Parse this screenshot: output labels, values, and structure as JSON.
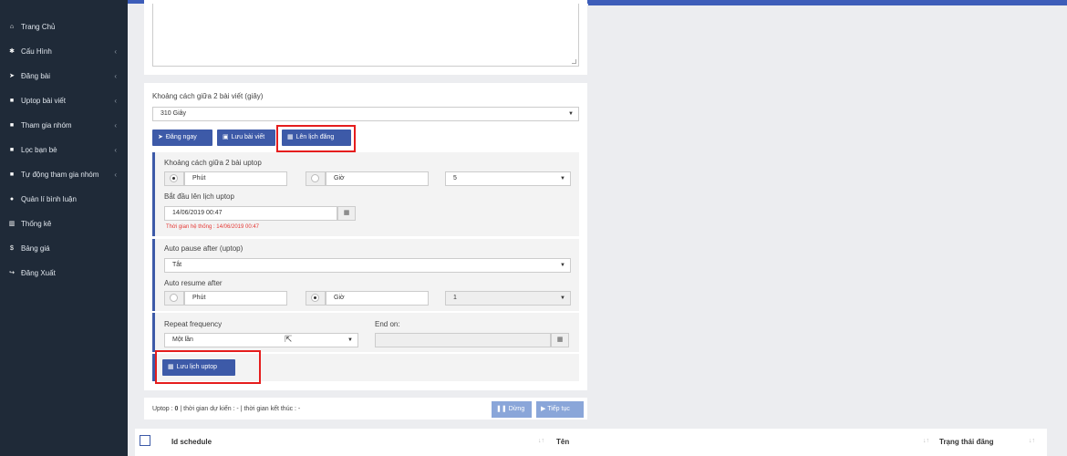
{
  "sidebar": {
    "items": [
      {
        "label": "Trang Chủ",
        "icon": "home-icon",
        "glyph": "⌂",
        "chevron": ""
      },
      {
        "label": "Cấu Hình",
        "icon": "gear-icon",
        "glyph": "✱",
        "chevron": "‹"
      },
      {
        "label": "Đăng bài",
        "icon": "send-icon",
        "glyph": "➤",
        "chevron": "‹"
      },
      {
        "label": "Uptop bài viết",
        "icon": "square-icon",
        "glyph": "■",
        "chevron": "‹"
      },
      {
        "label": "Tham gia nhóm",
        "icon": "square-icon",
        "glyph": "■",
        "chevron": "‹"
      },
      {
        "label": "Lọc bạn bè",
        "icon": "square-icon",
        "glyph": "■",
        "chevron": "‹"
      },
      {
        "label": "Tự động tham gia nhóm",
        "icon": "square-icon",
        "glyph": "■",
        "chevron": "‹"
      },
      {
        "label": "Quản lí bình luận",
        "icon": "comment-icon",
        "glyph": "●",
        "chevron": ""
      },
      {
        "label": "Thống kê",
        "icon": "bar-chart-icon",
        "glyph": "▥",
        "chevron": ""
      },
      {
        "label": "Bảng giá",
        "icon": "dollar-icon",
        "glyph": "$",
        "chevron": ""
      },
      {
        "label": "Đăng Xuất",
        "icon": "logout-icon",
        "glyph": "↪",
        "chevron": ""
      }
    ]
  },
  "form": {
    "interval_label": "Khoảng cách giữa 2 bài viết (giây)",
    "interval_value": "310 Giây",
    "post_now_label": "Đăng ngay",
    "save_post_label": "Lưu bài viết",
    "schedule_label": "Lên lịch đăng"
  },
  "uptop": {
    "interval_label": "Khoảng cách giữa 2 bài uptop",
    "minute_label": "Phút",
    "hour_label": "Giờ",
    "interval_value": "5",
    "start_label": "Bắt đầu lên lịch uptop",
    "start_value": "14/06/2019 00:47",
    "system_time": "Thời gian hệ thống : 14/06/2019 00:47"
  },
  "pause": {
    "pause_label": "Auto pause after (uptop)",
    "pause_value": "Tắt",
    "resume_label": "Auto resume after",
    "minute_label": "Phút",
    "hour_label": "Giờ",
    "resume_value": "1"
  },
  "repeat": {
    "label": "Repeat frequency",
    "value": "Một lần",
    "end_label": "End on:",
    "save_label": "Lưu lịch uptop"
  },
  "status": {
    "text_prefix": "Uptop : ",
    "count": "0",
    "text_rest": " | thời gian dự kiến : - | thời gian kết thúc : -",
    "stop_label": "Dừng",
    "continue_label": "Tiếp tục"
  },
  "table": {
    "col_id": "Id schedule",
    "col_name": "Tên",
    "col_status": "Trạng thái đăng"
  }
}
